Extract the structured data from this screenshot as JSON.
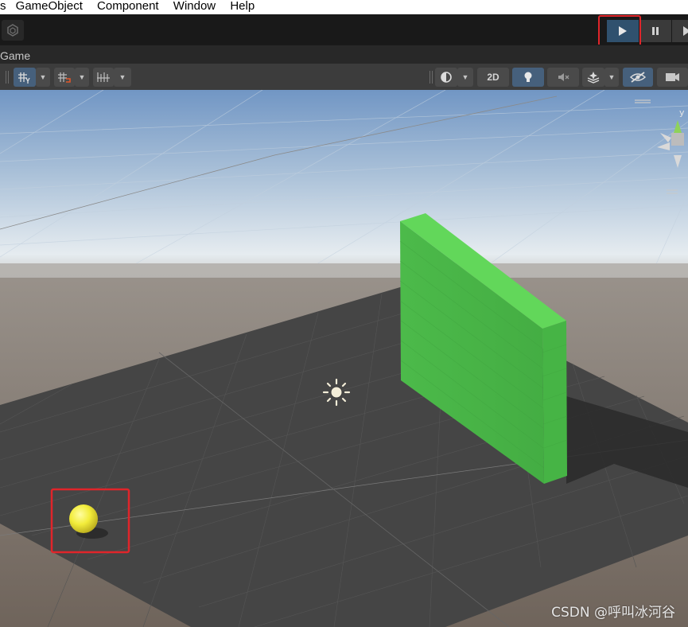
{
  "menu": {
    "items": [
      "s",
      "GameObject",
      "Component",
      "Window",
      "Help"
    ]
  },
  "toolbar": {
    "play_icon": "play-icon",
    "pause_icon": "pause-icon",
    "step_icon": "step-icon",
    "play_active_color": "#30516e"
  },
  "tab": {
    "label": "Game"
  },
  "scene_toolbar": {
    "mode_2d_label": "2D"
  },
  "scene": {
    "sky_top_color": "#7196c4",
    "horizon_color": "#e6ecf0",
    "ground_color": "#6f645b",
    "plane_color": "#454545",
    "wall_color": "#4cc24c",
    "ball_color": "#f2ec3a",
    "highlight_color": "#e0252a"
  },
  "watermark": "CSDN @呼叫冰河谷"
}
